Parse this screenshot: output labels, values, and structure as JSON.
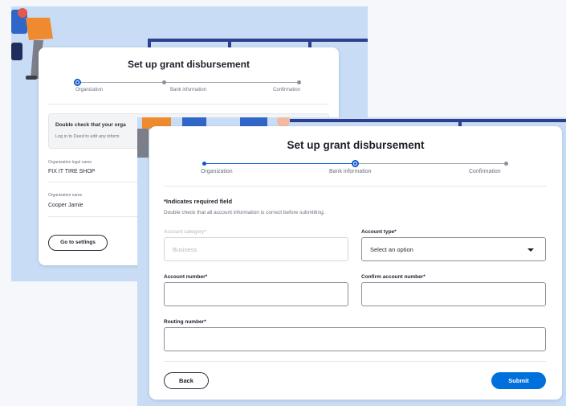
{
  "back_screen": {
    "title": "Set up grant disbursement",
    "steps": [
      "Organization",
      "Bank information",
      "Confirmation"
    ],
    "notice": {
      "title": "Double check that your orga",
      "body": "Log in to Deed to edit any inform"
    },
    "fields": [
      {
        "label": "Organization legal name",
        "value": "FIX IT TIRE SHOP"
      },
      {
        "label": "Organization name",
        "value": "Cooper Jamie"
      }
    ],
    "settings_button": "Go to settings"
  },
  "front_screen": {
    "title": "Set up grant disbursement",
    "steps": [
      "Organization",
      "Bank information",
      "Confirmation"
    ],
    "required_note": "*Indicates required field",
    "hint": "Double check that all account information is correct before submitting.",
    "account_category": {
      "label": "Account category*",
      "value": "Business"
    },
    "account_type": {
      "label": "Account type*",
      "value": "Select an option"
    },
    "account_number": {
      "label": "Account number*",
      "value": ""
    },
    "confirm_account_number": {
      "label": "Confirm account number*",
      "value": ""
    },
    "routing_number": {
      "label": "Routing number*",
      "value": ""
    },
    "back_button": "Back",
    "submit_button": "Submit"
  },
  "colors": {
    "background": "#c8ddf5",
    "accent": "#0071dc",
    "progress": "#0b57d0",
    "illustration_navy": "#2e3f8f"
  }
}
